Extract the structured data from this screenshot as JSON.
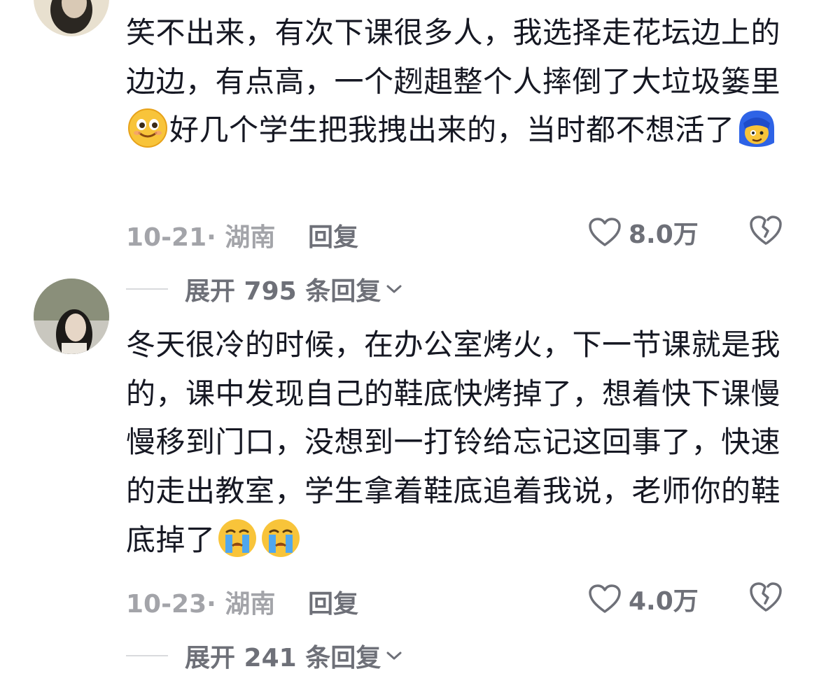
{
  "comments": [
    {
      "text_parts": [
        "笑不出来，有次下课很多人，我选择走花坛边上的边边，有点高，一个趔趄整个人摔倒了大垃圾篓里",
        "好几个学生把我拽出来的，当时都不想活了",
        ""
      ],
      "emoji_1": "smiling-eyes-emoji",
      "emoji_2": "blue-hair-face-emoji",
      "date_location": "10-21· 湖南",
      "reply_label": "回复",
      "likes": "8.0万",
      "expand_label": "展开 795 条回复"
    },
    {
      "text_parts": [
        "冬天很冷的时候，在办公室烤火，下一节课就是我的，课中发现自己的鞋底快烤掉了，想着快下课慢慢移到门口，没想到一打铃给忘记这回事了，快速的走出教室，学生拿着鞋底追着我说，老师你的鞋底掉了"
      ],
      "emoji_1": "crying-face-emoji",
      "emoji_2": "crying-face-emoji",
      "date_location": "10-23· 湖南",
      "reply_label": "回复",
      "likes": "4.0万",
      "expand_label": "展开 241 条回复"
    }
  ],
  "colors": {
    "text": "#161823",
    "meta": "#a3a4a9",
    "action": "#6e7078"
  },
  "icons": [
    "heart-outline-icon",
    "broken-heart-icon",
    "chevron-down-icon"
  ]
}
